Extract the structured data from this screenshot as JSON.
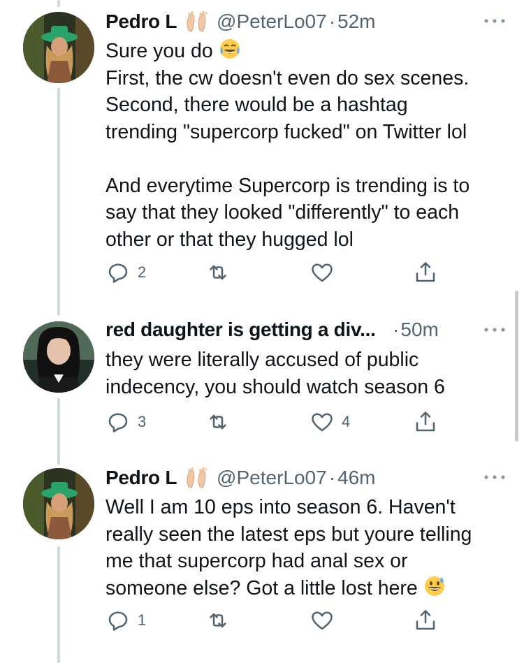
{
  "tweets": [
    {
      "name": "Pedro L",
      "handle": "@PeterLo07",
      "dot": "·",
      "time": "52m",
      "badge_icon": "feet-emoji",
      "lines": [
        "Sure you do ",
        "First, the cw doesn't even do sex scenes.",
        "Second, there would be a hashtag",
        "trending \"supercorp fucked\" on Twitter lol",
        "",
        "And everytime Supercorp is trending is to",
        "say that they looked \"differently\" to each",
        "other or that they hugged lol"
      ],
      "inline_emoji": "tears-of-joy-emoji",
      "reply_count": "2",
      "retweet_count": "",
      "like_count": ""
    },
    {
      "name": "red daughter is getting a div...",
      "handle": "",
      "dot": "·",
      "time": "50m",
      "badge_icon": "",
      "lines": [
        "they were literally accused of public",
        "indecency, you should watch season 6"
      ],
      "reply_count": "3",
      "retweet_count": "",
      "like_count": "4"
    },
    {
      "name": "Pedro L",
      "handle": "@PeterLo07",
      "dot": "·",
      "time": "46m",
      "badge_icon": "feet-emoji",
      "lines": [
        "Well I am 10 eps into season 6. Haven't",
        "really seen the latest eps but youre telling",
        "me that supercorp had anal sex or",
        "someone else? Got a little lost here "
      ],
      "inline_emoji": "grinning-sweat-emoji",
      "reply_count": "1",
      "retweet_count": "",
      "like_count": ""
    }
  ],
  "colors": {
    "text": "#0f1419",
    "secondary": "#536471",
    "thread_line": "#cfd9de"
  }
}
